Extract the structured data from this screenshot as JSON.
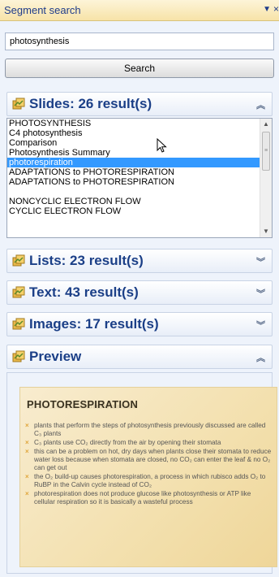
{
  "window": {
    "title": "Segment search"
  },
  "search": {
    "query": "photosynthesis",
    "button_label": "Search"
  },
  "sections": {
    "slides": {
      "title": "Slides: 26 result(s)",
      "chevron": "up"
    },
    "lists": {
      "title": "Lists: 23 result(s)",
      "chevron": "down"
    },
    "text": {
      "title": "Text: 43 result(s)",
      "chevron": "down"
    },
    "images": {
      "title": "Images: 17 result(s)",
      "chevron": "down"
    },
    "preview": {
      "title": "Preview",
      "chevron": "up"
    }
  },
  "slide_results": [
    "PHOTOSYNTHESIS",
    "C4 photosynthesis",
    "Comparison",
    "Photosynthesis Summary",
    "photorespiration",
    "ADAPTATIONS to PHOTORESPIRATION",
    "ADAPTATIONS to PHOTORESPIRATION",
    "",
    "NONCYCLIC ELECTRON FLOW",
    "CYCLIC ELECTRON FLOW"
  ],
  "selected_index": 4,
  "preview_slide": {
    "title": "PHOTORESPIRATION",
    "bullets": [
      "plants that perform the steps of photosynthesis previously discussed are called C₃ plants",
      "C₃ plants use CO₂ directly from the air by opening their stomata",
      "this can be a problem on hot, dry days when plants close their stomata to reduce water loss because when stomata are closed, no CO₂ can enter the leaf & no O₂ can get out",
      "the O₂ build-up causes photorespiration, a process in which rubisco adds O₂ to RuBP in the Calvin cycle instead of CO₂",
      "photorespiration does not produce glucose like photosynthesis or ATP like cellular respiration so it is basically a wasteful process"
    ]
  },
  "colors": {
    "header_text": "#1b3f87",
    "selection": "#3399ff",
    "title_bar": "#f7e3a8",
    "slide_bg": "#f3e0ae",
    "bullet_mark": "#e0a53a"
  },
  "icons": {
    "section": "folder-icon",
    "dropdown": "chevron-down-icon",
    "close": "close-icon"
  }
}
